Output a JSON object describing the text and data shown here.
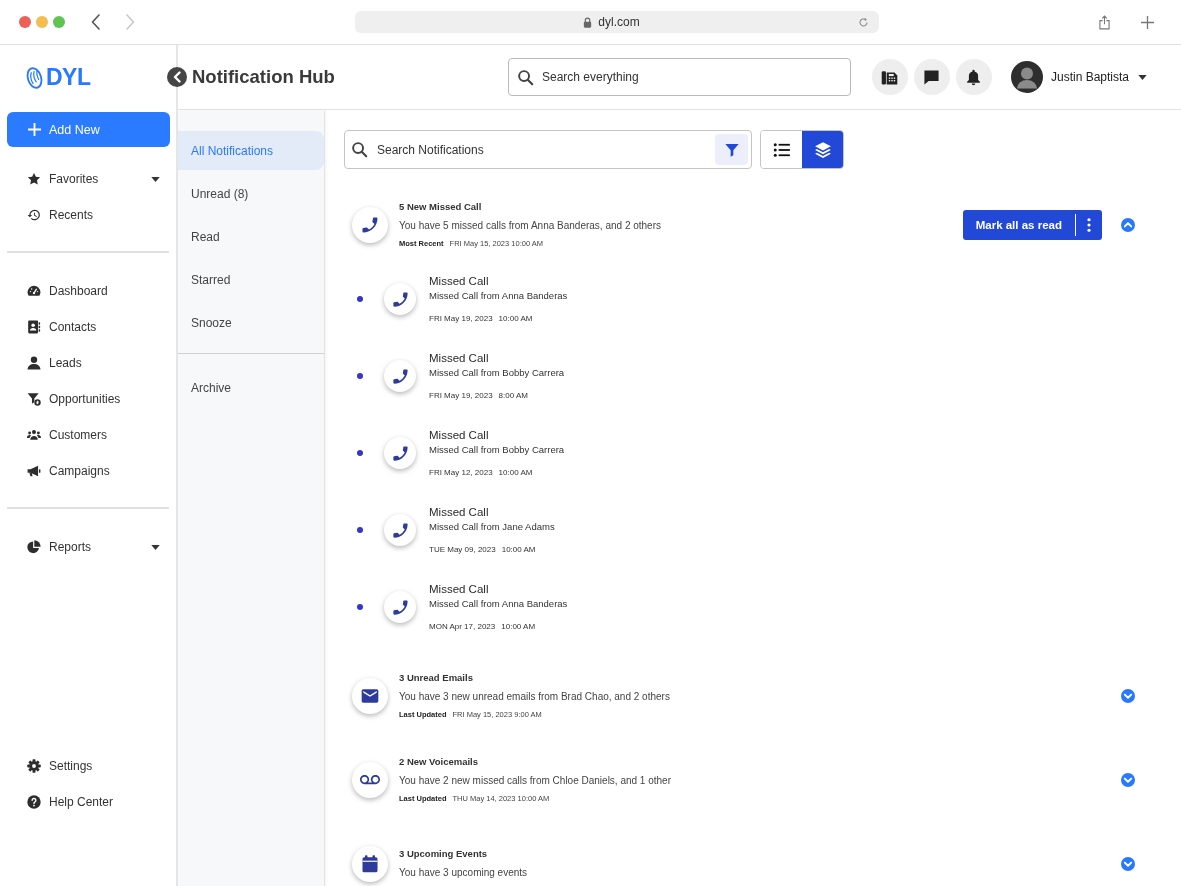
{
  "browser": {
    "nav": [
      {
        "disabled": false
      },
      {
        "disabled": true
      }
    ],
    "url": "dyl.com"
  },
  "sidebar": {
    "logo": "DYL",
    "add_button": "Add New",
    "sections": [
      {
        "items": [
          {
            "label": "Favorites",
            "has_submenu": true
          },
          {
            "label": "Recents",
            "has_submenu": false
          }
        ]
      },
      {
        "items": [
          {
            "label": "Dashboard",
            "has_submenu": false
          },
          {
            "label": "Contacts",
            "has_submenu": false
          },
          {
            "label": "Leads",
            "has_submenu": false
          },
          {
            "label": "Opportunities",
            "has_submenu": false
          },
          {
            "label": "Customers",
            "has_submenu": false
          },
          {
            "label": "Campaigns",
            "has_submenu": false
          }
        ]
      },
      {
        "items": [
          {
            "label": "Reports",
            "has_submenu": true
          }
        ]
      }
    ],
    "footer": [
      {
        "label": "Settings"
      },
      {
        "label": "Help Center"
      }
    ]
  },
  "header": {
    "title": "Notification Hub",
    "search": {
      "placeholder": "Search everything"
    },
    "user": {
      "name": "Justin Baptista"
    }
  },
  "notification_nav": {
    "sections": [
      {
        "items": [
          {
            "label": "All Notifications",
            "selected": true
          },
          {
            "label": "Unread (8)",
            "selected": false
          },
          {
            "label": "Read",
            "selected": false
          },
          {
            "label": "Starred",
            "selected": false
          },
          {
            "label": "Snooze",
            "selected": false
          }
        ]
      },
      {
        "items": [
          {
            "label": "Archive",
            "selected": false
          }
        ]
      }
    ]
  },
  "toolbar": {
    "search": {
      "placeholder": "Search Notifications"
    },
    "view_modes": [
      {
        "selected": false
      },
      {
        "selected": true
      }
    ]
  },
  "groups": [
    {
      "kind": "call",
      "title": "5 New Missed Call",
      "description": "You have 5 missed calls from Anna Banderas, and 2 others",
      "meta_label": "Most Recent",
      "meta_value": "FRI May 15, 2023 10:00 AM",
      "action": "Mark all as read",
      "expanded": true,
      "children": [
        {
          "kind": "call",
          "title": "Missed Call",
          "description": "Missed Call from Anna Banderas",
          "date": "FRI May 19, 2023",
          "time": "10:00 AM",
          "unread": true
        },
        {
          "kind": "call",
          "title": "Missed Call",
          "description": "Missed Call from Bobby Carrera",
          "date": "FRI May 19, 2023",
          "time": "8:00 AM",
          "unread": true
        },
        {
          "kind": "call",
          "title": "Missed Call",
          "description": "Missed Call from Bobby Carrera",
          "date": "FRI May 12, 2023",
          "time": "10:00 AM",
          "unread": true
        },
        {
          "kind": "call",
          "title": "Missed Call",
          "description": "Missed Call from Jane Adams",
          "date": "TUE May 09, 2023",
          "time": "10:00 AM",
          "unread": true
        },
        {
          "kind": "call",
          "title": "Missed Call",
          "description": "Missed Call from Anna Banderas",
          "date": "MON Apr 17, 2023",
          "time": "10:00 AM",
          "unread": true
        }
      ]
    },
    {
      "kind": "email",
      "title": "3 Unread Emails",
      "description": "You have 3 new unread emails from Brad Chao, and 2 others",
      "meta_label": "Last Updated",
      "meta_value": "FRI May 15, 2023 9:00 AM",
      "expanded": false
    },
    {
      "kind": "voicemail",
      "title": "2 New Voicemails",
      "description": "You have 2 new missed calls from Chloe Daniels, and 1 other",
      "meta_label": "Last Updated",
      "meta_value": "THU May 14, 2023 10:00 AM",
      "expanded": false
    },
    {
      "kind": "event",
      "title": "3 Upcoming Events",
      "description": "You have 3 upcoming events",
      "expanded": false
    }
  ]
}
